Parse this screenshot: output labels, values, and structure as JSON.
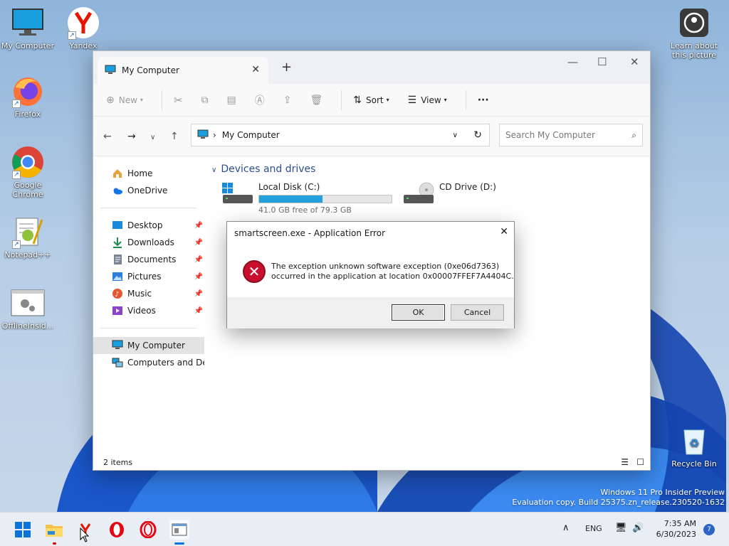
{
  "desktop": {
    "icons": [
      {
        "label": "My Computer"
      },
      {
        "label": "Yandex"
      },
      {
        "label": "Firefox"
      },
      {
        "label": "Google Chrome"
      },
      {
        "label": "Notepad++"
      },
      {
        "label": "OfflineInsid..."
      },
      {
        "label": "Learn about this picture"
      },
      {
        "label": "Recycle Bin"
      }
    ]
  },
  "explorer": {
    "tab_title": "My Computer",
    "toolbar": {
      "new_label": "New",
      "sort_label": "Sort",
      "view_label": "View",
      "more_label": "···"
    },
    "address": {
      "location": "My Computer",
      "search_placeholder": "Search My Computer"
    },
    "sidebar": {
      "items": [
        {
          "label": "Home"
        },
        {
          "label": "OneDrive"
        },
        {
          "label": "Desktop"
        },
        {
          "label": "Downloads"
        },
        {
          "label": "Documents"
        },
        {
          "label": "Pictures"
        },
        {
          "label": "Music"
        },
        {
          "label": "Videos"
        },
        {
          "label": "My Computer"
        },
        {
          "label": "Computers and Devi"
        }
      ]
    },
    "content": {
      "group_title": "Devices and drives",
      "drives": [
        {
          "name": "Local Disk (C:)",
          "free_text": "41.0 GB free of 79.3 GB",
          "used_fraction": 0.48
        },
        {
          "name": "CD Drive (D:)"
        }
      ]
    },
    "status": "2 items"
  },
  "dialog": {
    "title": "smartscreen.exe - Application Error",
    "message_line1": "The exception unknown software exception (0xe06d7363)",
    "message_line2": "occurred in the application at location 0x00007FFEF7A4404C.",
    "ok_label": "OK",
    "cancel_label": "Cancel"
  },
  "watermark": {
    "line1": "Windows 11 Pro Insider Preview",
    "line2": "Evaluation copy. Build 25375.zn_release.230520-1632"
  },
  "taskbar": {
    "lang": "ENG",
    "time": "7:35 AM",
    "date": "6/30/2023",
    "notifications": "7"
  },
  "colors": {
    "accent": "#26a0da",
    "error": "#c8102e",
    "link_blue": "#2a4e8c"
  }
}
